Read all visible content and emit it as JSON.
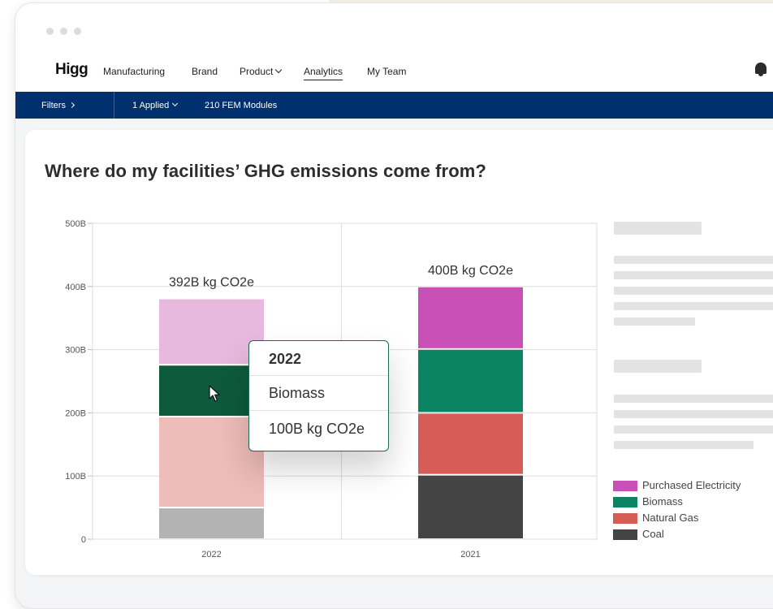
{
  "window": {
    "controls": [
      "close",
      "minimize",
      "maximize"
    ]
  },
  "nav": {
    "logo": "Higg",
    "items": [
      {
        "label": "Manufacturing",
        "has_dropdown": false,
        "active": false
      },
      {
        "label": "Brand",
        "has_dropdown": false,
        "active": false
      },
      {
        "label": "Product",
        "has_dropdown": true,
        "active": false
      },
      {
        "label": "Analytics",
        "has_dropdown": false,
        "active": true
      },
      {
        "label": "My Team",
        "has_dropdown": false,
        "active": false
      }
    ],
    "right_icon": "bell-icon"
  },
  "filterbar": {
    "filters_label": "Filters",
    "applied_label": "1 Applied",
    "modules_label": "210 FEM Modules",
    "background": "#00306e"
  },
  "card": {
    "title": "Where do my facilities’ GHG emissions come from?"
  },
  "tooltip": {
    "year": "2022",
    "category": "Biomass",
    "value": "100B kg CO2e"
  },
  "chart_data": {
    "type": "bar",
    "stacked": true,
    "categories": [
      "2022",
      "2021"
    ],
    "ylim": [
      0,
      500
    ],
    "yticks": [
      0,
      100,
      200,
      300,
      400,
      500
    ],
    "ytick_labels": [
      "0",
      "100B",
      "200B",
      "300B",
      "400B",
      "500B"
    ],
    "xlabel": "",
    "ylabel": "",
    "grid": true,
    "bar_totals": [
      "392B kg CO2e",
      "400B kg CO2e"
    ],
    "series": [
      {
        "name": "Coal",
        "color": "#444444",
        "faded_color": "#b3b3b3",
        "values": [
          50,
          102
        ]
      },
      {
        "name": "Natural Gas",
        "color": "#d65c58",
        "faded_color": "#eebcb9",
        "values": [
          144,
          98
        ]
      },
      {
        "name": "Biomass",
        "color": "#0a8462",
        "faded_color": "#0e5a3c",
        "values": [
          82,
          101
        ]
      },
      {
        "name": "Purchased Electricity",
        "color": "#c850b7",
        "faded_color": "#e8b9de",
        "values": [
          105,
          99
        ]
      }
    ],
    "highlighted": {
      "category": "2022",
      "series": "Biomass"
    },
    "legend": {
      "position": "right",
      "order": [
        "Purchased Electricity",
        "Biomass",
        "Natural Gas",
        "Coal"
      ]
    }
  }
}
